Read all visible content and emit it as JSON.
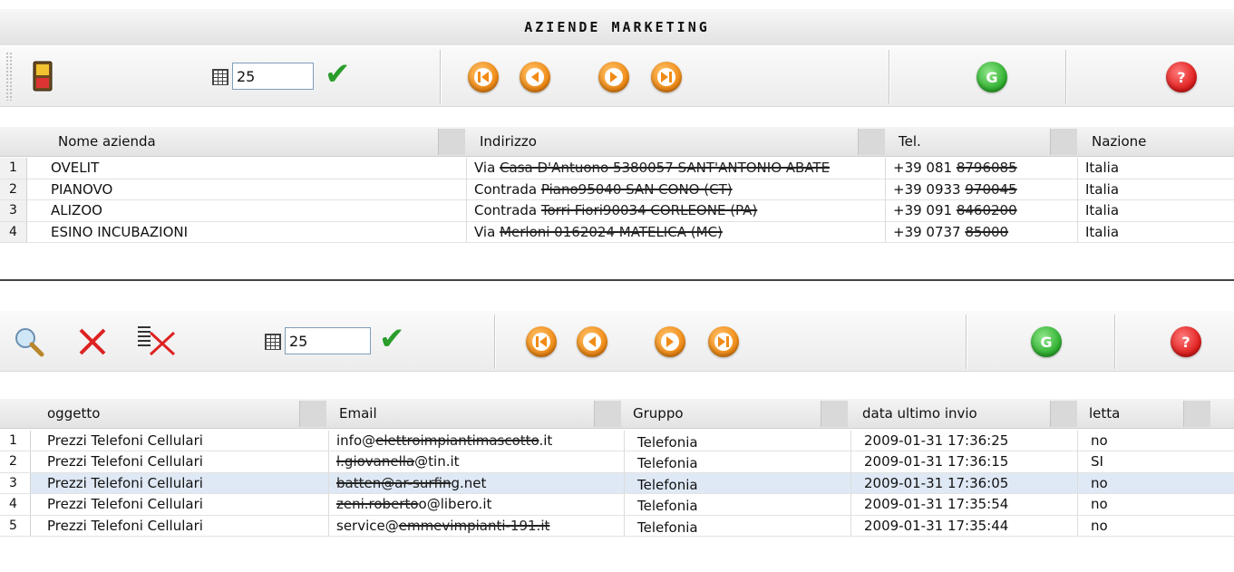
{
  "app": {
    "title": "AZIENDE MARKETING"
  },
  "top_toolbar": {
    "rows_per_page": "25",
    "icons": [
      "save-icon",
      "grid-icon",
      "confirm-check-icon",
      "first-page-icon",
      "prev-page-icon",
      "next-page-icon",
      "last-page-icon",
      "go-icon",
      "help-icon"
    ],
    "go_label": "G",
    "help_label": "?"
  },
  "companies_table": {
    "columns": [
      "Nome azienda",
      "Indirizzo",
      "Tel.",
      "Nazione"
    ],
    "rows": [
      {
        "n": "1",
        "name": "OVELIT",
        "addr_prefix": "Via ",
        "addr_hidden": "Casa D'Antuono 5380057 SANT'ANTONIO ABATE",
        "tel_prefix": "+39 081 ",
        "tel_hidden": "8796085",
        "country": "Italia"
      },
      {
        "n": "2",
        "name": "PIANOVO",
        "addr_prefix": "Contrada ",
        "addr_hidden": "Piano95040 SAN CONO (CT)",
        "tel_prefix": "+39 0933 ",
        "tel_hidden": "970045",
        "country": "Italia"
      },
      {
        "n": "3",
        "name": "ALIZOO",
        "addr_prefix": "Contrada ",
        "addr_hidden": "Torri Fiori90034 CORLEONE (PA)",
        "tel_prefix": "+39 091 ",
        "tel_hidden": "8460200",
        "country": "Italia"
      },
      {
        "n": "4",
        "name": "ESINO INCUBAZIONI",
        "addr_prefix": "Via ",
        "addr_hidden": "Merloni 0162024 MATELICA (MC)",
        "tel_prefix": "+39 0737 ",
        "tel_hidden": "85000",
        "country": "Italia"
      }
    ]
  },
  "bottom_toolbar": {
    "rows_per_page": "25",
    "icons": [
      "search-icon",
      "delete-icon",
      "delete-all-icon",
      "grid-icon",
      "confirm-check-icon",
      "first-page-icon",
      "prev-page-icon",
      "next-page-icon",
      "last-page-icon",
      "go-icon",
      "help-icon"
    ],
    "go_label": "G",
    "help_label": "?"
  },
  "emails_table": {
    "columns": [
      "oggetto",
      "Email",
      "Gruppo",
      "data ultimo invio",
      "letta"
    ],
    "rows": [
      {
        "n": "1",
        "subject": "Prezzi Telefoni Cellulari",
        "email_pre": "info@",
        "email_hidden": "elettroimpiantimascotto",
        "email_post": ".it",
        "group": "Telefonia",
        "date": "2009-01-31 17:36:25",
        "read": "no"
      },
      {
        "n": "2",
        "subject": "Prezzi Telefoni Cellulari",
        "email_pre": "",
        "email_hidden": "l.giovanella",
        "email_post": "@tin.it",
        "group": "Telefonia",
        "date": "2009-01-31 17:36:15",
        "read": "SI"
      },
      {
        "n": "3",
        "subject": "Prezzi Telefoni Cellulari",
        "email_pre": "",
        "email_hidden": "batten@ar-surfin",
        "email_post": "g.net",
        "group": "Telefonia",
        "date": "2009-01-31 17:36:05",
        "read": "no"
      },
      {
        "n": "4",
        "subject": "Prezzi Telefoni Cellulari",
        "email_pre": "",
        "email_hidden": "zeni.roberto",
        "email_post": "o@libero.it",
        "group": "Telefonia",
        "date": "2009-01-31 17:35:54",
        "read": "no"
      },
      {
        "n": "5",
        "subject": "Prezzi Telefoni Cellulari",
        "email_pre": "service@",
        "email_hidden": "emmevimpianti-191.it",
        "email_post": "",
        "group": "Telefonia",
        "date": "2009-01-31 17:35:44",
        "read": "no"
      }
    ]
  }
}
